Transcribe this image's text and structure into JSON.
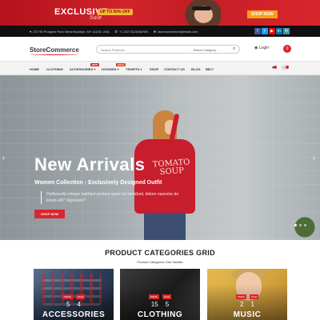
{
  "promo": {
    "title": "EXCLUSIVE",
    "script": "Sale",
    "pill": "UP TO 50% OFF",
    "shop_label": "SHOP NOW"
  },
  "topbar": {
    "address": "237 95 Prospect Park West Brooklyn, NY 11215, USA",
    "phone": "+1 222 9123456789",
    "email": "storecommerce@email.com",
    "social": [
      "f",
      "t",
      "▶",
      "in",
      "✉"
    ]
  },
  "header": {
    "logo": "StoreCommerce",
    "search_placeholder": "Search Products...",
    "category_select": "- Select Category -",
    "login_label": "Login",
    "cart_count": "0"
  },
  "nav": {
    "items": [
      "HOME",
      "CLOTHING",
      "ACCESSORIES",
      "HOODIES",
      "TSHIRTS",
      "SHOP",
      "CONTACT US",
      "BLOG",
      "BELT"
    ],
    "badges": {
      "new": "NEW",
      "sale": "SALE"
    },
    "wishlist_count": "0",
    "cart_count": "0"
  },
  "hero": {
    "title": "New Arrivals",
    "subtitle": "Women Collection - Exclusively Designed Outfit",
    "description": "Perferendis integer habitant pretium quae nisl tincidunt, dolore nascetur do lorem elit? Dignissim?",
    "button": "SHOP NOW",
    "sweater_print": "TOMATO SOUP",
    "prev_arrow": "‹",
    "next_arrow": "›"
  },
  "categories": {
    "title": "PRODUCT CATEGORIES GRID",
    "subtitle": "Product Categories Grid Subtitle",
    "cards": [
      {
        "label": "ACCESSORIES",
        "tag1": "ITEMS",
        "tag2": "SALE",
        "count1": "5",
        "count2": "4"
      },
      {
        "label": "CLOTHING",
        "tag1": "ITEMS",
        "tag2": "SALE",
        "count1": "15",
        "count2": "5"
      },
      {
        "label": "MUSIC",
        "tag1": "ITEMS",
        "tag2": "SALE",
        "count1": "2",
        "count2": "1"
      }
    ]
  },
  "colors": {
    "accent": "#d9262d",
    "topbar": "#111111",
    "facebook": "#3b5998",
    "twitter": "#1da1f2",
    "youtube": "#ff0000",
    "linkedin": "#0077b5",
    "email": "#4a90a4"
  }
}
